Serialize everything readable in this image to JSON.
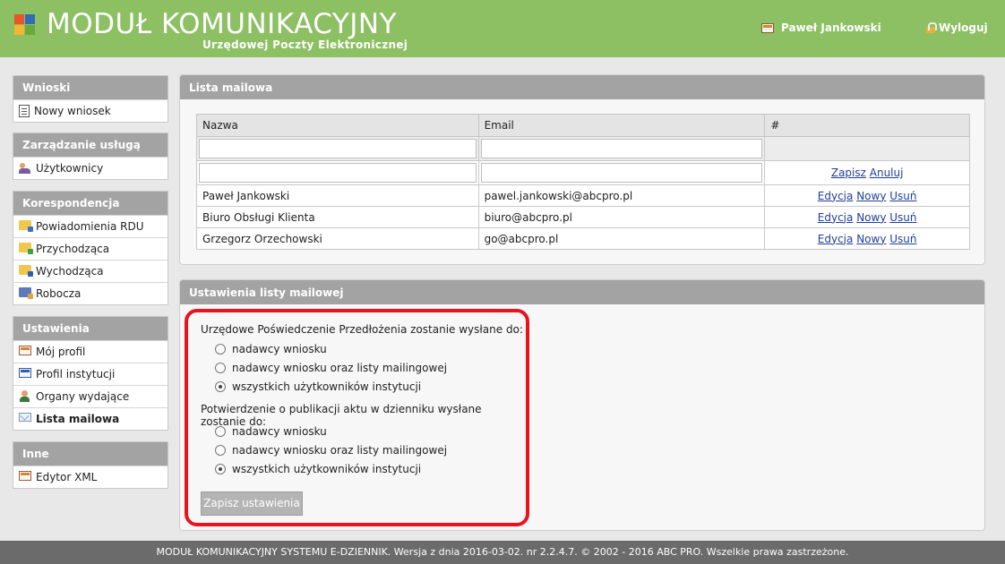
{
  "header": {
    "title": "MODUŁ KOMUNIKACYJNY",
    "subtitle": "Urzędowej Poczty Elektronicznej",
    "user_name": "Paweł Jankowski",
    "logout_label": "Wyloguj",
    "colors": {
      "bar": "#8cc063",
      "logo": [
        "#e8552a",
        "#2f6db5",
        "#f2b632",
        "#6aaa3c"
      ]
    }
  },
  "sidebar": {
    "groups": [
      {
        "title": "Wnioski",
        "items": [
          {
            "label": "Nowy wniosek",
            "icon": "document-icon"
          }
        ]
      },
      {
        "title": "Zarządzanie usługą",
        "items": [
          {
            "label": "Użytkownicy",
            "icon": "users-icon"
          }
        ]
      },
      {
        "title": "Korespondencja",
        "items": [
          {
            "label": "Powiadomienia RDU",
            "icon": "folder-icon"
          },
          {
            "label": "Przychodząca",
            "icon": "folder-in-icon"
          },
          {
            "label": "Wychodząca",
            "icon": "folder-out-icon"
          },
          {
            "label": "Robocza",
            "icon": "folder-draft-icon"
          }
        ]
      },
      {
        "title": "Ustawienia",
        "items": [
          {
            "label": "Mój profil",
            "icon": "id-card-icon"
          },
          {
            "label": "Profil instytucji",
            "icon": "id-card-icon"
          },
          {
            "label": "Organy wydające",
            "icon": "person-icon"
          },
          {
            "label": "Lista mailowa",
            "icon": "mail-icon",
            "active": true
          }
        ]
      },
      {
        "title": "Inne",
        "items": [
          {
            "label": "Edytor XML",
            "icon": "id-card-icon"
          }
        ]
      }
    ]
  },
  "mailing_list": {
    "title": "Lista mailowa",
    "columns": [
      "Nazwa",
      "Email",
      "#"
    ],
    "edit_actions": {
      "save": "Zapisz",
      "cancel": "Anuluj"
    },
    "rows": [
      {
        "name": "Paweł Jankowski",
        "email": "pawel.jankowski@abcpro.pl"
      },
      {
        "name": "Biuro Obsługi Klienta",
        "email": "biuro@abcpro.pl"
      },
      {
        "name": "Grzegorz Orzechowski",
        "email": "go@abcpro.pl"
      }
    ],
    "row_actions": {
      "edit": "Edycja",
      "new": "Nowy",
      "delete": "Usuń"
    }
  },
  "settings": {
    "title": "Ustawienia listy mailowej",
    "question1": "Urzędowe Poświedczenie Przedłożenia zostanie wysłane do:",
    "question2": "Potwierdzenie o publikacji aktu w dzienniku wysłane zostanie do:",
    "options": [
      "nadawcy wniosku",
      "nadawcy wniosku oraz listy mailingowej",
      "wszystkich użytkowników instytucji"
    ],
    "selected1": 2,
    "selected2": 2,
    "save_label": "Zapisz ustawienia",
    "highlight_color": "#e8131f"
  },
  "footer": {
    "text": "MODUŁ KOMUNIKACYJNY SYSTEMU E-DZIENNIK. Wersja z dnia 2016-03-02. nr 2.2.4.7. © 2002 - 2016 ABC PRO. Wszelkie prawa zastrzeżone."
  }
}
